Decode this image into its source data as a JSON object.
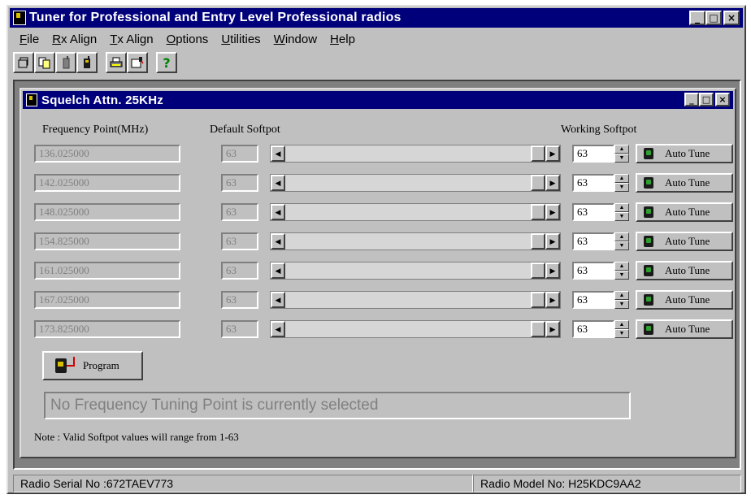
{
  "app": {
    "title": "Tuner for Professional and Entry Level Professional radios",
    "window_buttons": {
      "minimize": "_",
      "maximize": "□",
      "close": "×"
    }
  },
  "menu": [
    {
      "label": "File",
      "accel": "F",
      "rest": "ile"
    },
    {
      "label": "Rx Align",
      "accel": "R",
      "rest": "x Align"
    },
    {
      "label": "Tx Align",
      "accel": "T",
      "rest": "x Align"
    },
    {
      "label": "Options",
      "accel": "O",
      "rest": "ptions"
    },
    {
      "label": "Utilities",
      "accel": "U",
      "rest": "tilities"
    },
    {
      "label": "Window",
      "accel": "W",
      "rest": "indow"
    },
    {
      "label": "Help",
      "accel": "H",
      "rest": "elp"
    }
  ],
  "toolbar": {
    "icons": [
      "open-icon",
      "copy-icon",
      "radio-icon",
      "radio-read-icon",
      "print-icon",
      "program-icon",
      "help-icon"
    ],
    "help_glyph": "?"
  },
  "child_window": {
    "title": "Squelch Attn. 25KHz",
    "columns": {
      "frequency": "Frequency Point(MHz)",
      "default": "Default Softpot",
      "working": "Working Softpot"
    },
    "rows": [
      {
        "frequency": "136.025000",
        "default": "63",
        "working": "63",
        "auto_tune": "Auto Tune",
        "slider_fraction": 1.0
      },
      {
        "frequency": "142.025000",
        "default": "63",
        "working": "63",
        "auto_tune": "Auto Tune",
        "slider_fraction": 1.0
      },
      {
        "frequency": "148.025000",
        "default": "63",
        "working": "63",
        "auto_tune": "Auto Tune",
        "slider_fraction": 1.0
      },
      {
        "frequency": "154.825000",
        "default": "63",
        "working": "63",
        "auto_tune": "Auto Tune",
        "slider_fraction": 1.0
      },
      {
        "frequency": "161.025000",
        "default": "63",
        "working": "63",
        "auto_tune": "Auto Tune",
        "slider_fraction": 1.0
      },
      {
        "frequency": "167.025000",
        "default": "63",
        "working": "63",
        "auto_tune": "Auto Tune",
        "slider_fraction": 1.0
      },
      {
        "frequency": "173.825000",
        "default": "63",
        "working": "63",
        "auto_tune": "Auto Tune",
        "slider_fraction": 1.0
      }
    ],
    "program_button": "Program",
    "status_message": "No Frequency Tuning Point is currently selected",
    "note": "Note : Valid Softpot values will range from 1-63"
  },
  "statusbar": {
    "serial": "Radio Serial No :672TAEV773",
    "model": "Radio Model No: H25KDC9AA2"
  }
}
